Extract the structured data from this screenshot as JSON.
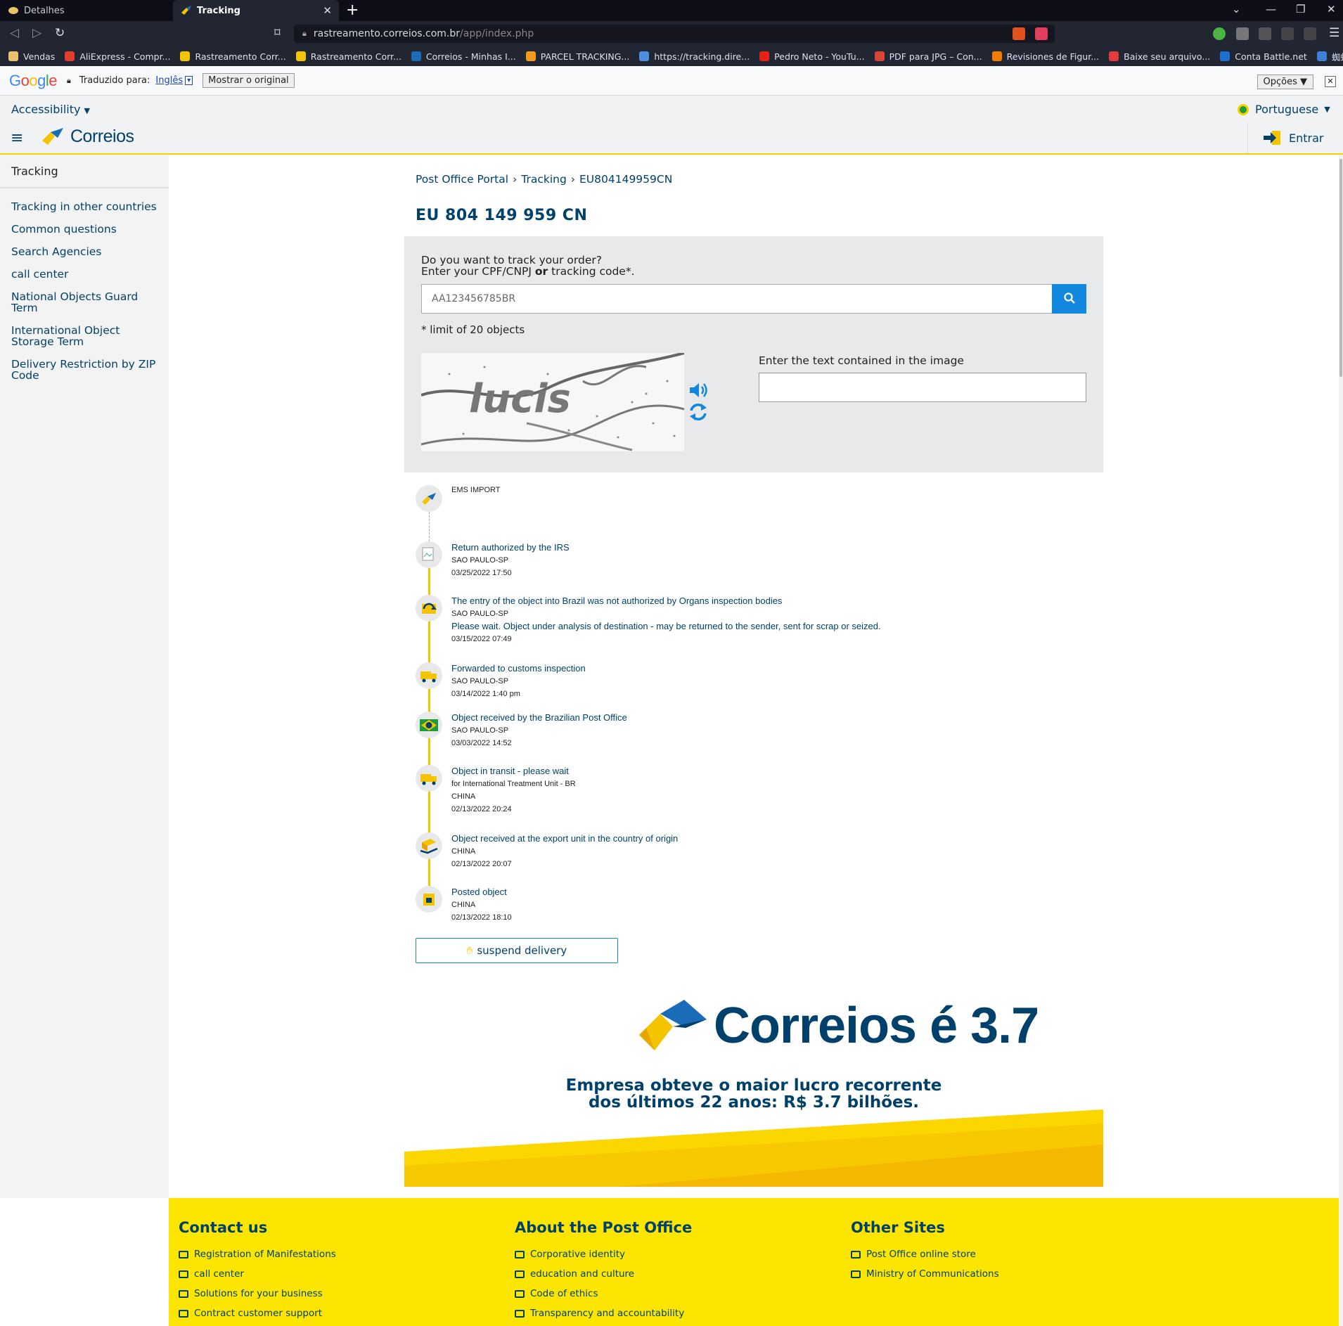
{
  "browser": {
    "tabs": [
      {
        "label": "Detalhes"
      },
      {
        "label": "Tracking"
      }
    ],
    "url_host": "rastreamento.correios.com.br",
    "url_path": "/app/index.php",
    "bookmarks": [
      {
        "label": "Vendas",
        "color": "#e9c26b"
      },
      {
        "label": "AliExpress - Compr...",
        "color": "#e43d30"
      },
      {
        "label": "Rastreamento Corr...",
        "color": "#f5c400"
      },
      {
        "label": "Rastreamento Corr...",
        "color": "#f5c400"
      },
      {
        "label": "Correios - Minhas I...",
        "color": "#1a6bb8"
      },
      {
        "label": "PARCEL TRACKING...",
        "color": "#f29a1d"
      },
      {
        "label": "https://tracking.dire...",
        "color": "#4d90e0"
      },
      {
        "label": "Pedro Neto - YouTu...",
        "color": "#e62117"
      },
      {
        "label": "PDF para JPG – Con...",
        "color": "#d8463a"
      },
      {
        "label": "Revisiones de Figur...",
        "color": "#f57c00"
      },
      {
        "label": "Baixe seu arquivo...",
        "color": "#e33b3b"
      },
      {
        "label": "Conta Battle.net",
        "color": "#1f6fd0"
      },
      {
        "label": "蜘蛛侠 SH Figuarts...",
        "color": "#3c7fd6"
      }
    ],
    "translate": {
      "translated_to": "Traduzido para:",
      "language": "Inglês",
      "show_original": "Mostrar o original",
      "options": "Opções ▼"
    }
  },
  "site": {
    "accessibility": "Accessibility",
    "language": "Portuguese",
    "logo": "Correios",
    "login": "Entrar"
  },
  "sidebar": {
    "title": "Tracking",
    "items": [
      {
        "label": "Tracking in other countries"
      },
      {
        "label": "Common questions"
      },
      {
        "label": "Search Agencies"
      },
      {
        "label": "call center"
      },
      {
        "label": "National Objects Guard Term"
      },
      {
        "label": "International Object Storage Term"
      },
      {
        "label": "Delivery Restriction by ZIP Code"
      }
    ]
  },
  "breadcrumb": [
    "Post Office Portal",
    "Tracking",
    "EU804149959CN"
  ],
  "page_title": "EU 804 149 959 CN",
  "search": {
    "question_line1": "Do you want to track your order?",
    "question_line2_a": "Enter your CPF/CNPJ ",
    "question_line2_b": "or",
    "question_line2_c": " tracking code*.",
    "placeholder": "AA123456785BR",
    "limit_note": "* limit of 20 objects",
    "captcha_label": "Enter the text contained in the image",
    "captcha_text": "lucis"
  },
  "events": [
    {
      "title": "EMS IMPORT",
      "lines": [],
      "icon": "correios-logo-icon"
    },
    {
      "title": "Return authorized by the IRS",
      "lines": [
        "SAO PAULO-SP",
        "03/25/2022 17:50"
      ],
      "icon": "broken-image-icon"
    },
    {
      "title": "The entry of the object into Brazil was not authorized by Organs inspection bodies",
      "lines": [
        "SAO PAULO-SP",
        "Please wait. Object under analysis of destination - may be returned to the sender, sent for scrap or seized.",
        "03/15/2022 07:49"
      ],
      "icon": "return-arrow-icon"
    },
    {
      "title": "Forwarded to customs inspection",
      "lines": [
        "SAO PAULO-SP",
        "03/14/2022 1:40 pm"
      ],
      "icon": "truck-icon"
    },
    {
      "title": "Object received by the Brazilian Post Office",
      "lines": [
        "SAO PAULO-SP",
        "03/03/2022 14:52"
      ],
      "icon": "brazil-flag-icon"
    },
    {
      "title": "Object in transit - please wait",
      "lines": [
        "for International Treatment Unit - BR",
        "CHINA",
        "02/13/2022 20:24"
      ],
      "icon": "truck-icon"
    },
    {
      "title": "Object received at the export unit in the country of origin",
      "lines": [
        "CHINA",
        "02/13/2022 20:07"
      ],
      "icon": "box-hand-icon"
    },
    {
      "title": "Posted object",
      "lines": [
        "CHINA",
        "02/13/2022 18:10"
      ],
      "icon": "mailbox-icon"
    }
  ],
  "suspend_label": "suspend delivery",
  "banner": {
    "heading": "Correios é 3.7",
    "sub_line1": "Empresa obteve o maior lucro recorrente",
    "sub_line2": "dos últimos 22 anos: R$ 3.7 bilhões."
  },
  "footer": {
    "columns": [
      {
        "title": "Contact us",
        "items": [
          "Registration of Manifestations",
          "call center",
          "Solutions for your business",
          "Contract customer support"
        ]
      },
      {
        "title": "About the Post Office",
        "items": [
          "Corporative identity",
          "education and culture",
          "Code of ethics",
          "Transparency and accountability"
        ]
      },
      {
        "title": "Other Sites",
        "items": [
          "Post Office online store",
          "Ministry of Communications"
        ]
      }
    ]
  },
  "colors": {
    "brand_blue": "#00416b",
    "brand_yellow": "#fce500",
    "accent_blue": "#1187de"
  }
}
